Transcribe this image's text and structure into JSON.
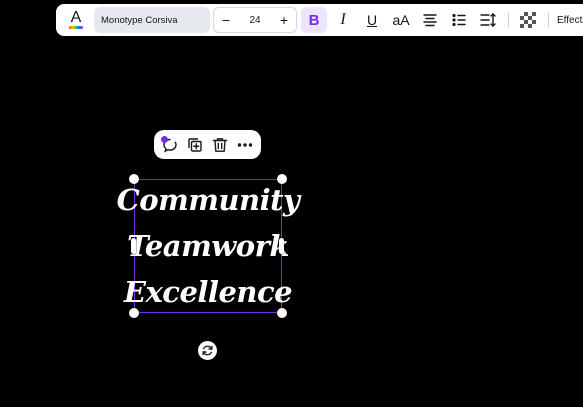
{
  "toolbar": {
    "text_color_glyph": "A",
    "font_family_value": "Monotype Corsiva",
    "font_size_value": "24",
    "decrease_glyph": "−",
    "increase_glyph": "+",
    "bold_glyph": "B",
    "italic_glyph": "I",
    "underline_glyph": "U",
    "case_glyph": "aA",
    "effects_label": "Effects",
    "bold_active_color": "#7d2ae8"
  },
  "text_element": {
    "lines": [
      "Community",
      "Teamwork",
      "Excellence"
    ],
    "selection_color": "#7d2ae8"
  },
  "icons": {
    "context_menu": [
      "magic-comment-icon",
      "duplicate-icon",
      "trash-icon",
      "more-icon"
    ],
    "rotate": "rotate-icon"
  }
}
